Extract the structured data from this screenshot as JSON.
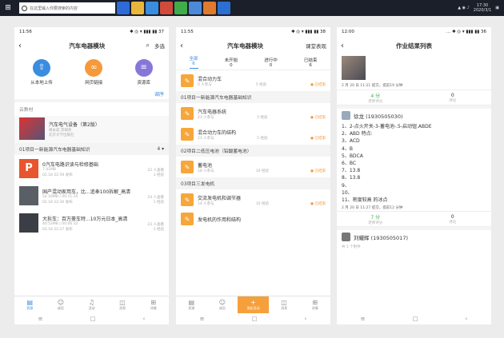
{
  "taskbar": {
    "search_placeholder": "在这里输入你要搜索的内容",
    "time": "17:30",
    "date": "2020/3/1"
  },
  "p1": {
    "status_time": "11:56",
    "status_right": "✱ ◎ ▾ ▮▮▮ ▮▮ 37",
    "title": "汽车电器模块",
    "multi": "多选",
    "actions": [
      {
        "icon": "⇧",
        "label": "从本地上传",
        "color": "#3a8dde"
      },
      {
        "icon": "🔗",
        "label": "网页链接",
        "color": "#f59a3b"
      },
      {
        "icon": "≡",
        "label": "资源库",
        "color": "#8677d9"
      }
    ],
    "sort": "调序",
    "cloud": "云教材",
    "book_title": "汽车电气设备（第2版）",
    "book_author": "谢永成 李端英",
    "book_pub": "北京大学出版社",
    "project": "01项目一新能源汽车电器基础知识",
    "project_count": "4",
    "items": [
      {
        "title": "0汽车电路识读与检修基础",
        "size": "7.41MB",
        "views": "22 人查看",
        "date": "02.18 22:59 发布",
        "count": "1 经验"
      },
      {
        "title": "国产混动家用车，比...追奉100拆解_高清",
        "size": "52.16MB",
        "dur": "00:11:35",
        "views": "24 人查看",
        "date": "02.18 22:30 发布",
        "count": "1 经验"
      },
      {
        "title": "大拆车：百万豪车特...10万元日本_高清",
        "size": "40.52MB",
        "dur": "00:06:32",
        "views": "23 人查看",
        "date": "02.18 22:27 发布",
        "count": "1 经验"
      }
    ],
    "tabs": [
      {
        "icon": "▤",
        "label": "资源"
      },
      {
        "icon": "☺",
        "label": "成员"
      },
      {
        "icon": "♫",
        "label": "活动"
      },
      {
        "icon": "◫",
        "label": "消息"
      },
      {
        "icon": "⊞",
        "label": "详情"
      }
    ]
  },
  "p2": {
    "status_time": "11:55",
    "status_right": "✱ ◎ ▾ ▮▮▮ ▮▮ 38",
    "title": "汽车电器模块",
    "action": "课堂表现",
    "filter": [
      {
        "label": "全部",
        "count": "6"
      },
      {
        "label": "未开始",
        "count": "0"
      },
      {
        "label": "进行中",
        "count": "0"
      },
      {
        "label": "已结束",
        "count": "6"
      }
    ],
    "top_item": {
      "title": "混合动力车",
      "people": "0 人参与",
      "exp": "5 经验",
      "state": "已结束"
    },
    "sections": [
      {
        "name": "01项目一新能源汽车电器基础知识",
        "items": [
          {
            "title": "汽车电器系统",
            "people": "23 人参与",
            "exp": "5 经验",
            "state": "已结束"
          },
          {
            "title": "混合动力车的结构",
            "people": "23 人参与",
            "exp": "5 经验",
            "state": "已结束"
          }
        ]
      },
      {
        "name": "02项目二低压电池（铅酸蓄电池）",
        "items": [
          {
            "title": "蓄电池",
            "people": "18 人参与",
            "exp": "10 经验",
            "state": "已结束"
          }
        ]
      },
      {
        "name": "03项目三发电机",
        "items": [
          {
            "title": "交流发电机和调节器",
            "people": "14 人参与",
            "exp": "10 经验",
            "state": "已结束"
          },
          {
            "title": "发电机的作用和结构",
            "people": "",
            "exp": "",
            "state": ""
          }
        ]
      }
    ],
    "tabs": [
      {
        "icon": "▤",
        "label": "资源"
      },
      {
        "icon": "☺",
        "label": "成员"
      },
      {
        "icon": "+",
        "label": "发起活动"
      },
      {
        "icon": "◫",
        "label": "消息"
      },
      {
        "icon": "⊞",
        "label": "详情"
      }
    ]
  },
  "p3": {
    "status_time": "12:00",
    "status_right": "… ✱ ◎ ▾ ▮▮▮ ▮▮ 36",
    "title": "作业结果列表",
    "sub1": "2 月 20 日 11:21 提交，提前19 分钟",
    "score1": "4 分",
    "score1_lbl": "老师评分",
    "comment1": "0",
    "comment1_lbl": "评论",
    "student": "徐龙 (1930505030)",
    "answers": [
      "1、2-点火开关-3-蓄电池-.5-启动钮.ABDE",
      "2、ABD 特点:",
      "3、ACD",
      "4、B",
      "5、BDCA",
      "6、BC",
      "7、13.8",
      "8、13.8",
      "9、",
      "10、",
      "11、密度较高    的冰点"
    ],
    "sub2": "2 月 20 日 11:27 提交，提前12 分钟",
    "score2": "7 分",
    "score2_lbl": "老师评分",
    "comment2": "0",
    "comment2_lbl": "评论",
    "student2": "刘耀辉 (1930505017)",
    "attach": "共 1 个附件"
  }
}
